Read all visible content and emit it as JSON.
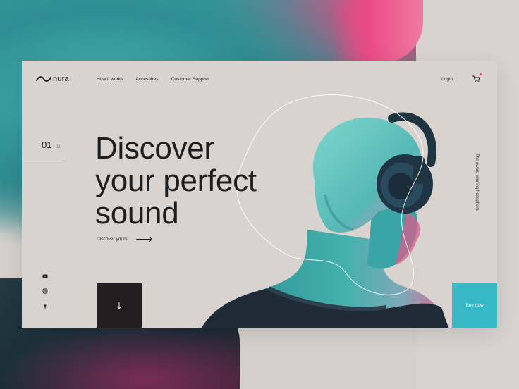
{
  "brand": {
    "name": "nura"
  },
  "nav": {
    "items": [
      "How it works",
      "Accesoires",
      "Customer Support"
    ],
    "login": "Login",
    "cart_icon": "cart-icon"
  },
  "slider": {
    "current": "01",
    "total": "/ 03"
  },
  "hero": {
    "headline": [
      "Discover",
      "your perfect",
      "sound"
    ],
    "cta": "Discover yours",
    "side_text": "The award winning headphone",
    "buy": "Buy now",
    "scroll_icon": "arrow-down-icon"
  },
  "social": [
    "youtube-icon",
    "instagram-icon",
    "facebook-icon"
  ],
  "colors": {
    "accent": "#37b8c6",
    "dark": "#231f20",
    "background": "#d9d3cf",
    "pink": "#e8427c",
    "teal": "#47b4b3"
  }
}
